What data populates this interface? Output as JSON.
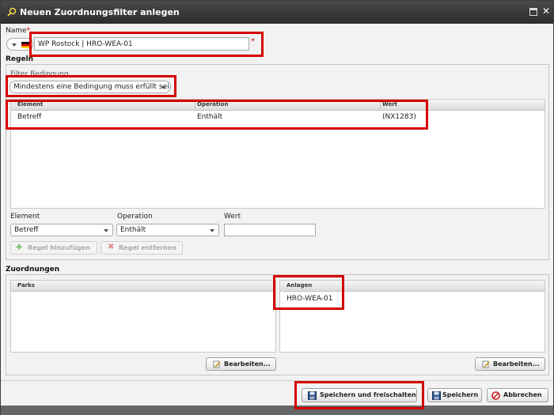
{
  "window": {
    "title": "Neuen Zuordnungsfilter anlegen"
  },
  "name_field": {
    "label": "Name",
    "required_mark": "*",
    "value": "WP Rostock | HRO-WEA-01"
  },
  "regeln": {
    "title": "Regeln",
    "filter_label": "Filter Bedingung",
    "filter_value": "Mindestens eine Bedingung muss erfüllt sei",
    "grid": {
      "columns": [
        "Element",
        "Operation",
        "Wert"
      ],
      "rows": [
        {
          "element": "Betreff",
          "operation": "Enthält",
          "wert": "(NX1283)"
        }
      ]
    },
    "editor": {
      "element_label": "Element",
      "element_value": "Betreff",
      "operation_label": "Operation",
      "operation_value": "Enthält",
      "wert_label": "Wert",
      "wert_value": ""
    },
    "add_button": "Regel hinzufügen",
    "remove_button": "Regel entfernen"
  },
  "zuordnungen": {
    "title": "Zuordnungen",
    "parks": {
      "header": "Parks",
      "items": [],
      "edit_button": "Bearbeiten..."
    },
    "anlagen": {
      "header": "Anlagen",
      "items": [
        "HRO-WEA-01"
      ],
      "edit_button": "Bearbeiten..."
    }
  },
  "footer": {
    "save_activate": "Speichern und freischalten",
    "save": "Speichern",
    "cancel": "Abbrechen"
  },
  "colors": {
    "highlight": "#d40000",
    "titlebar": "#3a3a3a",
    "required": "#d00000"
  }
}
